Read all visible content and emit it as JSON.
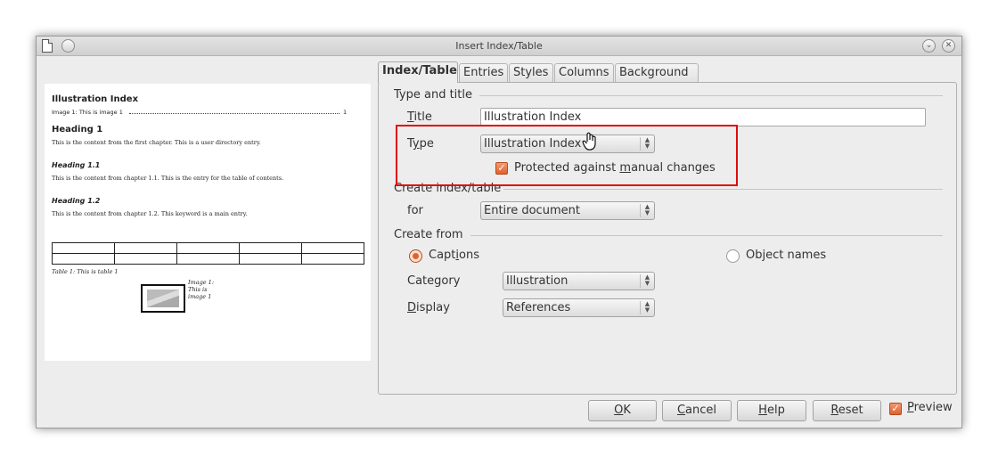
{
  "window": {
    "title": "Insert Index/Table"
  },
  "preview": {
    "heading_index": "Illustration Index",
    "entry": "Image 1: This is image 1",
    "entry_page": "1",
    "heading1": "Heading 1",
    "text1": "This is the content from the first chapter. This is a user directory entry.",
    "heading11": "Heading 1.1",
    "text11": "This is the content from chapter 1.1. This is the entry for the table of contents.",
    "heading12": "Heading 1.2",
    "text12": "This is the content from chapter 1.2. This keyword is a main entry.",
    "table_caption": "Table 1: This is table 1",
    "image_caption_1": "Image 1:",
    "image_caption_2": "This is",
    "image_caption_3": "image 1"
  },
  "tabs": [
    "Index/Table",
    "Entries",
    "Styles",
    "Columns",
    "Background"
  ],
  "type_and_title": {
    "group": "Type and title",
    "title_label": "Title",
    "title_value": "Illustration Index",
    "type_label": "Type",
    "type_value": "Illustration Index",
    "protected_label": "Protected against manual changes",
    "protected_checked": true
  },
  "create_index": {
    "group": "Create index/table",
    "for_label": "for",
    "for_value": "Entire document"
  },
  "create_from": {
    "group": "Create from",
    "captions_label": "Captions",
    "object_names_label": "Object names",
    "category_label": "Category",
    "category_value": "Illustration",
    "display_label": "Display",
    "display_value": "References"
  },
  "buttons": {
    "ok": "OK",
    "cancel": "Cancel",
    "help": "Help",
    "reset": "Reset",
    "preview": "Preview"
  },
  "colors": {
    "accent": "#e0622f",
    "highlight": "#e00b0b"
  }
}
